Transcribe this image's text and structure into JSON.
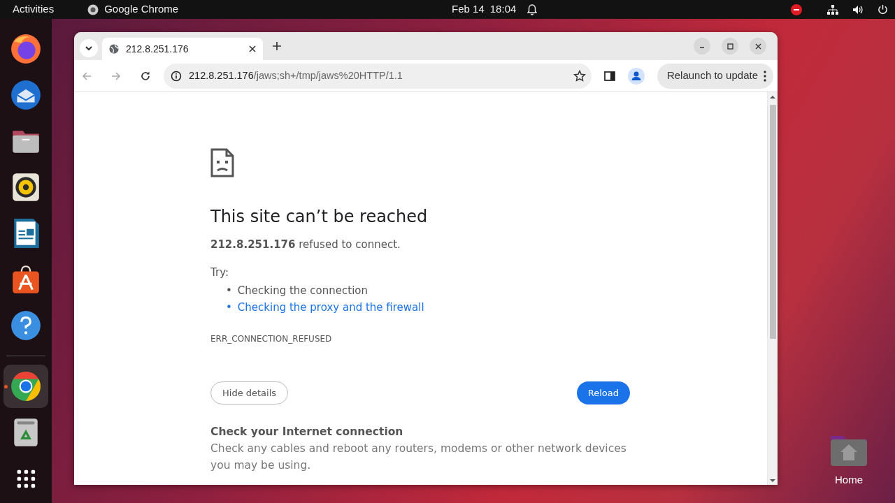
{
  "top_bar": {
    "activities": "Activities",
    "app_name": "Google Chrome",
    "date": "Feb 14",
    "time": "18:04"
  },
  "dock": {
    "items": [
      {
        "kind": "firefox",
        "selected": false
      },
      {
        "kind": "thunderbird",
        "selected": false
      },
      {
        "kind": "files",
        "selected": false
      },
      {
        "kind": "rhythmbox",
        "selected": false
      },
      {
        "kind": "writer",
        "selected": false
      },
      {
        "kind": "appstore",
        "selected": false
      },
      {
        "kind": "help",
        "selected": false
      },
      {
        "kind": "chrome",
        "selected": true
      },
      {
        "kind": "trash",
        "selected": false
      },
      {
        "kind": "apps",
        "selected": false
      }
    ]
  },
  "browser": {
    "tabs": [
      {
        "title": "212.8.251.176",
        "selected": true
      }
    ],
    "address": {
      "host": "212.8.251.176",
      "path": "/jaws;sh+/tmp/jaws%20HTTP/1.1"
    },
    "relaunch": "Relaunch to update",
    "page": {
      "title": "This site can’t be reached",
      "message": "**212.8.251.176** refused to connect.",
      "try_label": "Try:",
      "suggestions": [
        {
          "marker": "•",
          "text": "Checking the connection",
          "kind": "text"
        },
        {
          "marker": "•",
          "text": "Checking the proxy and the firewall",
          "kind": "link"
        }
      ],
      "error_code": "ERR_CONNECTION_REFUSED",
      "hide_button": "Hide details",
      "reload_button": "Reload",
      "details_heading": "Check your Internet connection",
      "details_text": "Check any cables and reboot any routers, modems or other network devices you may be using."
    }
  },
  "desktop_icons": [
    {
      "label": "Home"
    }
  ]
}
